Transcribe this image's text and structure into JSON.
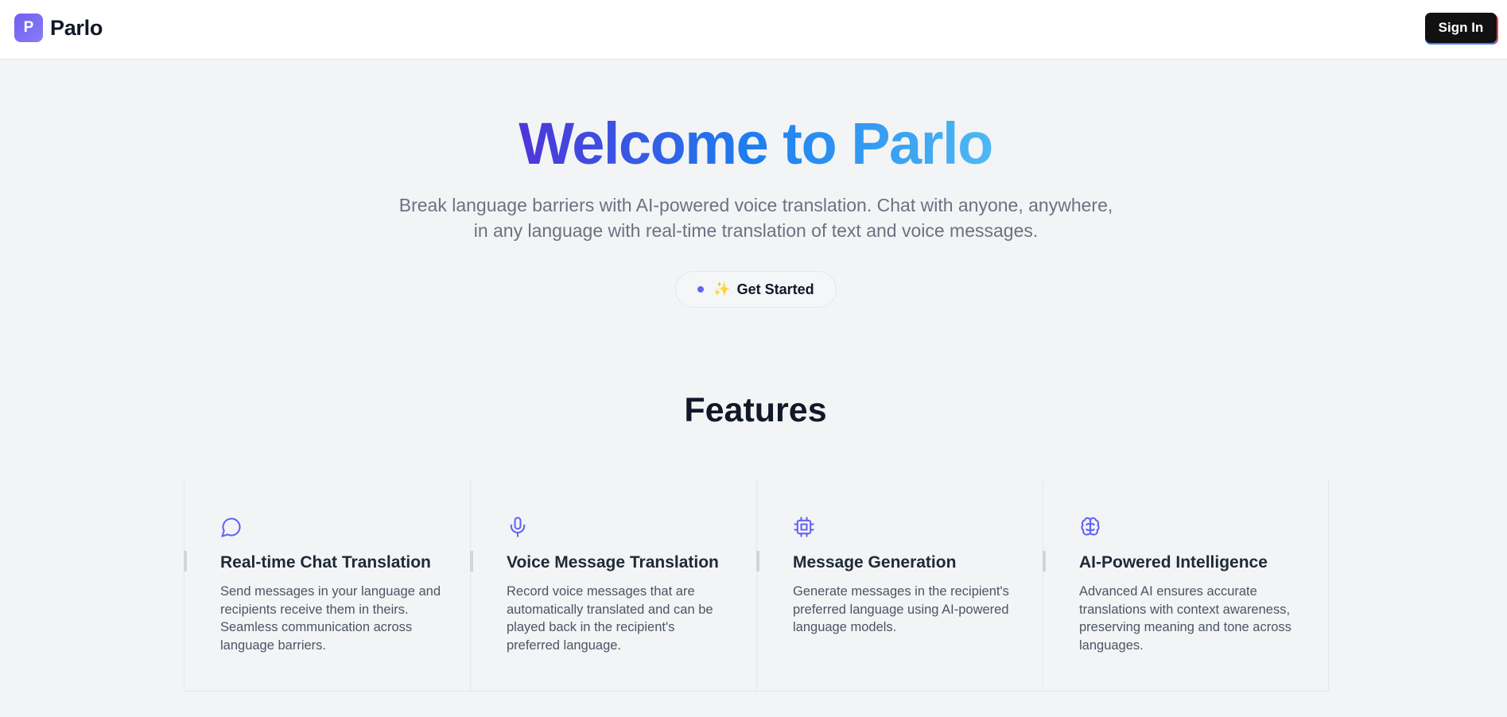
{
  "nav": {
    "logo_letter": "P",
    "brand": "Parlo",
    "signin_label": "Sign In"
  },
  "hero": {
    "title": "Welcome to Parlo",
    "subtitle": "Break language barriers with AI-powered voice translation. Chat with anyone, anywhere, in any language with real-time translation of text and voice messages.",
    "cta_icon": "sparkles-icon",
    "cta_label": "Get Started"
  },
  "features": {
    "heading": "Features",
    "items": [
      {
        "icon": "chat-bubble-icon",
        "title": "Real-time Chat Translation",
        "description": "Send messages in your language and recipients receive them in theirs. Seamless communication across language barriers."
      },
      {
        "icon": "microphone-icon",
        "title": "Voice Message Translation",
        "description": "Record voice messages that are automatically translated and can be played back in the recipient's preferred language."
      },
      {
        "icon": "cpu-chip-icon",
        "title": "Message Generation",
        "description": "Generate messages in the recipient's preferred language using AI-powered language models."
      },
      {
        "icon": "brain-icon",
        "title": "AI-Powered Intelligence",
        "description": "Advanced AI ensures accurate translations with context awareness, preserving meaning and tone across languages."
      }
    ]
  },
  "colors": {
    "accent": "#6366f1",
    "background": "#f3f4f6",
    "gradient_start": "#4f35d8",
    "gradient_end": "#4fb9f2"
  }
}
